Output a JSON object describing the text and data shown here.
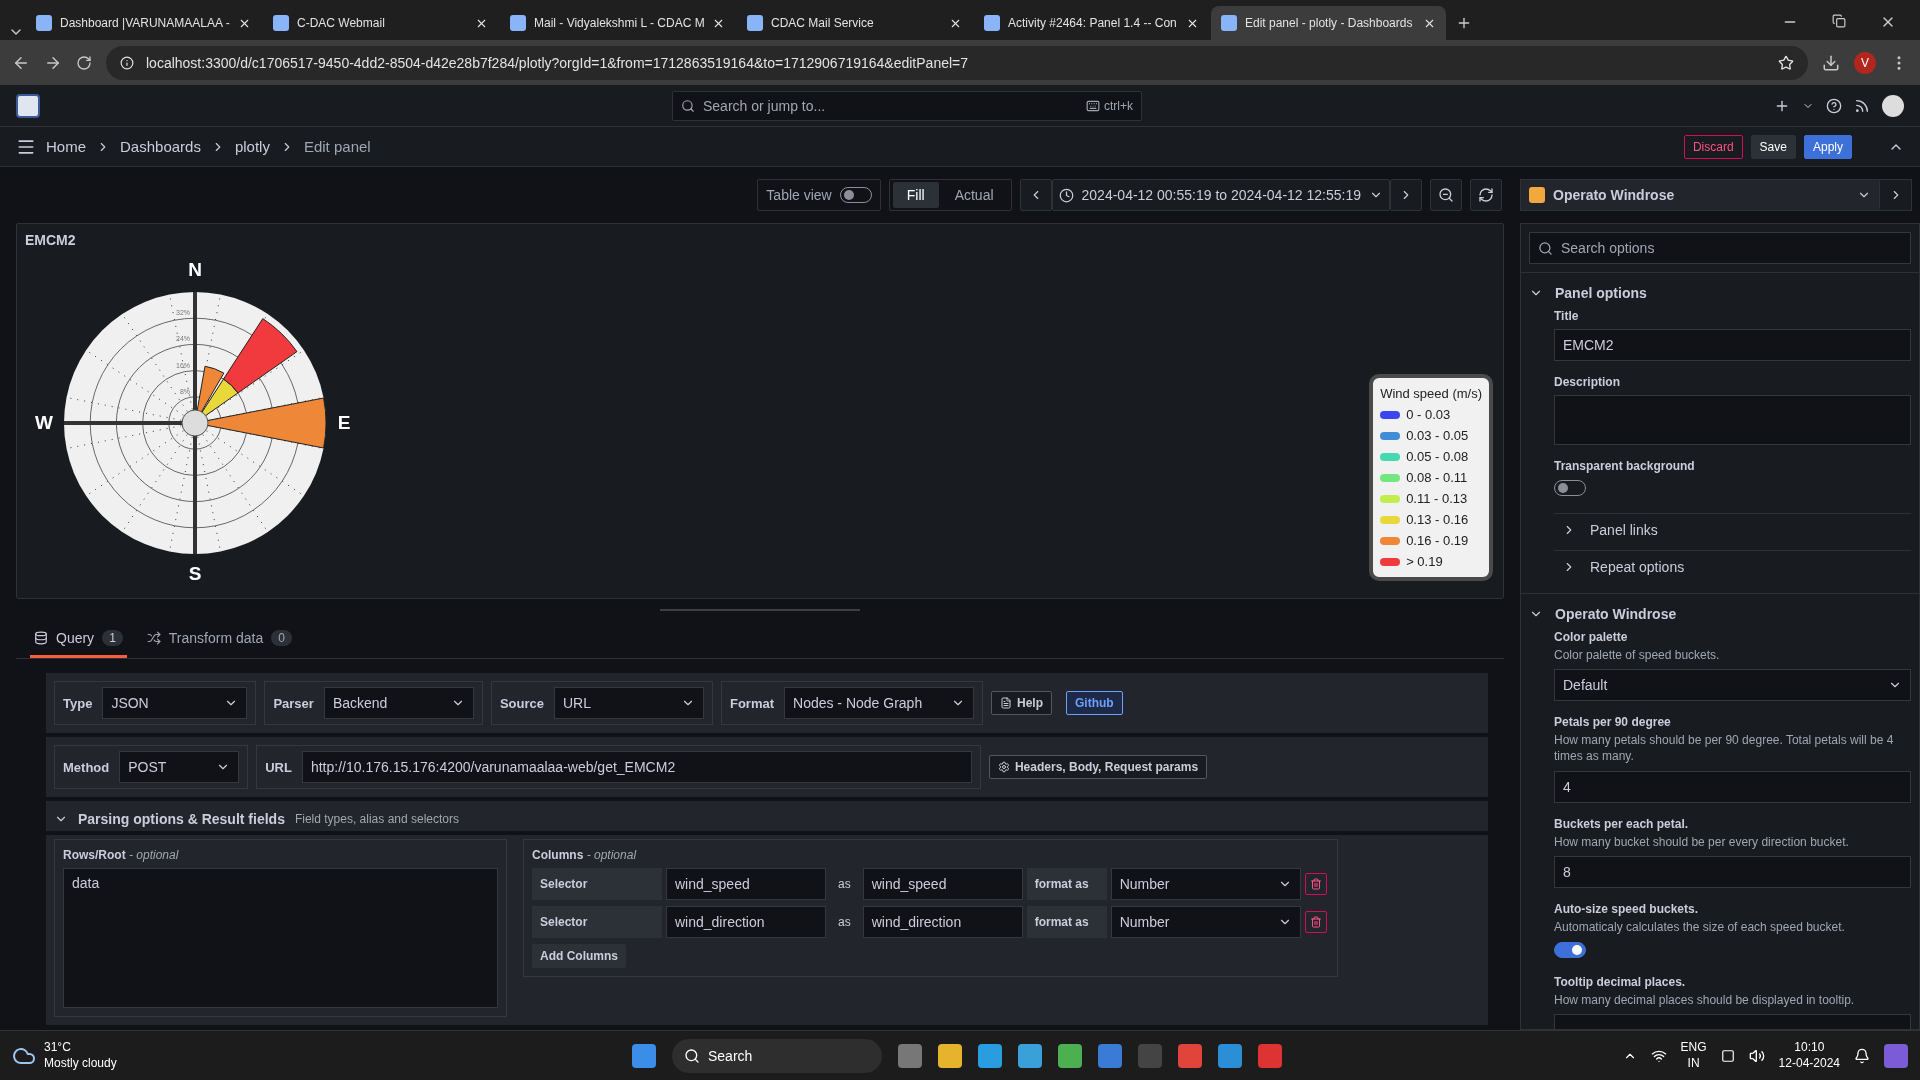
{
  "browser": {
    "tabs": [
      {
        "title": "Dashboard |VARUNAMAALAA -",
        "selected": false
      },
      {
        "title": "C-DAC Webmail",
        "selected": false
      },
      {
        "title": "Mail - Vidyalekshmi L - CDAC M",
        "selected": false
      },
      {
        "title": "CDAC Mail Service",
        "selected": false
      },
      {
        "title": "Activity #2464: Panel 1.4 -- Con",
        "selected": false
      },
      {
        "title": "Edit panel - plotly - Dashboards",
        "selected": true
      }
    ],
    "url": "localhost:3300/d/c1706517-9450-4dd2-8504-d42e28b7f284/plotly?orgId=1&from=1712863519164&to=1712906719164&editPanel=7",
    "profile_initial": "V"
  },
  "topbar": {
    "search_placeholder": "Search or jump to...",
    "shortcut": "ctrl+k"
  },
  "breadcrumbs": [
    "Home",
    "Dashboards",
    "plotly",
    "Edit panel"
  ],
  "actions": [
    {
      "label": "Discard",
      "kind": "danger"
    },
    {
      "label": "Save",
      "kind": "secondary"
    },
    {
      "label": "Apply",
      "kind": "primary"
    }
  ],
  "panel_toolbar": {
    "table_view": {
      "label": "Table view",
      "on": false
    },
    "sizing": [
      {
        "label": "Fill",
        "selected": true
      },
      {
        "label": "Actual",
        "selected": false
      }
    ],
    "time_range": "2024-04-12 00:55:19 to 2024-04-12 12:55:19"
  },
  "panel": {
    "title": "EMCM2",
    "compass": [
      "N",
      "E",
      "S",
      "W"
    ],
    "ring_labels": [
      "32%",
      "24%",
      "16%",
      "8%"
    ],
    "legend": {
      "title": "Wind speed (m/s)",
      "items": [
        {
          "label": "0 - 0.03",
          "color": "#3b45f0"
        },
        {
          "label": "0.03 - 0.05",
          "color": "#3e8dd6"
        },
        {
          "label": "0.05 - 0.08",
          "color": "#45d9b0"
        },
        {
          "label": "0.08 - 0.11",
          "color": "#74e67f"
        },
        {
          "label": "0.11 - 0.13",
          "color": "#c3ec4f"
        },
        {
          "label": "0.13 - 0.16",
          "color": "#e8d83a"
        },
        {
          "label": "0.16 - 0.19",
          "color": "#ee8838"
        },
        {
          "label": "> 0.19",
          "color": "#f03a3e"
        }
      ]
    }
  },
  "query_tabs": [
    {
      "label": "Query",
      "count": "1",
      "selected": true
    },
    {
      "label": "Transform data",
      "count": "0",
      "selected": false
    }
  ],
  "query": {
    "row1": [
      {
        "label": "Type",
        "value": "JSON"
      },
      {
        "label": "Parser",
        "value": "Backend"
      },
      {
        "label": "Source",
        "value": "URL"
      },
      {
        "label": "Format",
        "value": "Nodes - Node Graph"
      }
    ],
    "help": "Help",
    "github": "Github",
    "method": {
      "label": "Method",
      "value": "POST"
    },
    "url": {
      "label": "URL",
      "value": "http://10.176.15.176:4200/varunamaalaa-web/get_EMCM2"
    },
    "headers_button": "Headers, Body, Request params",
    "parsing": {
      "title": "Parsing options & Result fields",
      "hint": "Field types, alias and selectors",
      "expanded": true
    },
    "rows_root": {
      "label": "Rows/Root",
      "optional": "- optional",
      "value": "data"
    },
    "columns": {
      "label": "Columns",
      "optional": "- optional",
      "rows": [
        {
          "selector_label": "Selector",
          "selector": "wind_speed",
          "as": "as",
          "alias": "wind_speed",
          "format_label": "format as",
          "format": "Number"
        },
        {
          "selector_label": "Selector",
          "selector": "wind_direction",
          "as": "as",
          "alias": "wind_direction",
          "format_label": "format as",
          "format": "Number"
        }
      ],
      "add": "Add Columns"
    }
  },
  "options": {
    "visualization": "Operato Windrose",
    "search_placeholder": "Search options",
    "sections": [
      {
        "title": "Panel options",
        "expanded": true
      },
      {
        "title": "Panel links",
        "expanded": false
      },
      {
        "title": "Repeat options",
        "expanded": false
      },
      {
        "title": "Operato Windrose",
        "expanded": true
      }
    ],
    "title_field": {
      "label": "Title",
      "value": "EMCM2"
    },
    "description_label": "Description",
    "transparent": {
      "label": "Transparent background",
      "on": false
    },
    "color_palette": {
      "label": "Color palette",
      "help": "Color palette of speed buckets.",
      "value": "Default"
    },
    "petals": {
      "label": "Petals per 90 degree",
      "help": "How many petals should be per 90 degree. Total petals will be 4 times as many.",
      "value": "4"
    },
    "buckets": {
      "label": "Buckets per each petal.",
      "help": "How many bucket should be per every direction bucket.",
      "value": "8"
    },
    "autosize": {
      "label": "Auto-size speed buckets.",
      "help": "Automaticaly calculates the size of each speed bucket.",
      "on": true
    },
    "tooltip": {
      "label": "Tooltip decimal places.",
      "help": "How many decimal places should be displayed in tooltip."
    }
  },
  "taskbar": {
    "temperature": "31°C",
    "weather": "Mostly cloudy",
    "search": "Search",
    "lang": "ENG",
    "region": "IN",
    "time": "10:10",
    "date": "12-04-2024"
  }
}
